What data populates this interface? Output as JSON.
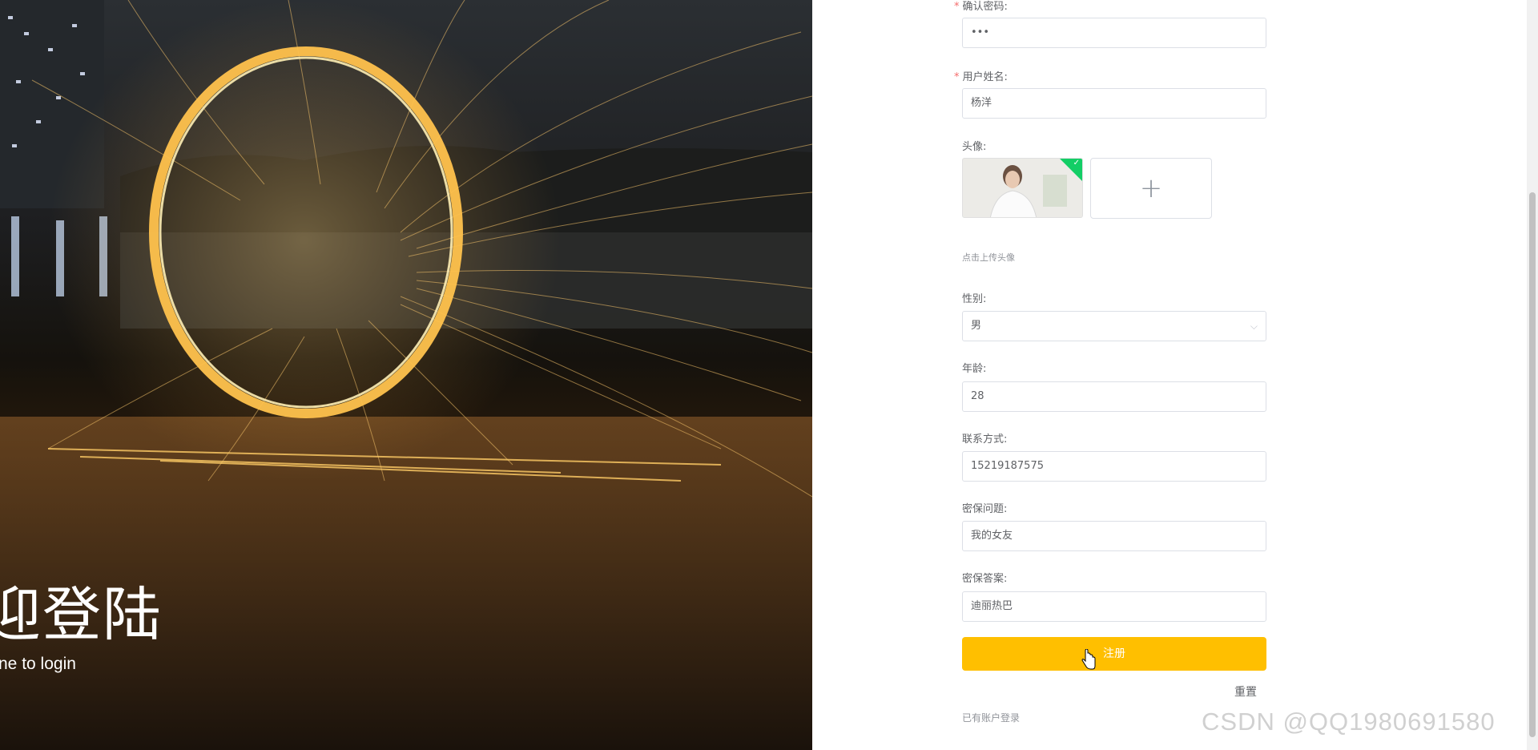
{
  "hero": {
    "title": "迎登陆",
    "subtitle": "ne to login"
  },
  "form": {
    "confirm_password": {
      "label": "确认密码:",
      "value": "•••"
    },
    "real_name": {
      "label": "用户姓名:",
      "value": "杨洋"
    },
    "avatar": {
      "label": "头像:",
      "tip": "点击上传头像",
      "add_icon": "plus-icon"
    },
    "gender": {
      "label": "性别:",
      "value": "男"
    },
    "age": {
      "label": "年龄:",
      "value": "28"
    },
    "contact": {
      "label": "联系方式:",
      "value": "15219187575"
    },
    "security_question": {
      "label": "密保问题:",
      "value": "我的女友"
    },
    "security_answer": {
      "label": "密保答案:",
      "value": "迪丽热巴"
    },
    "submit_label": "注册",
    "reset_label": "重置",
    "login_link": "已有账户登录"
  },
  "colors": {
    "primary_button": "#ffbf00",
    "required_mark": "#f56c6c",
    "upload_success": "#13ce66"
  },
  "watermark": "CSDN @QQ1980691580"
}
